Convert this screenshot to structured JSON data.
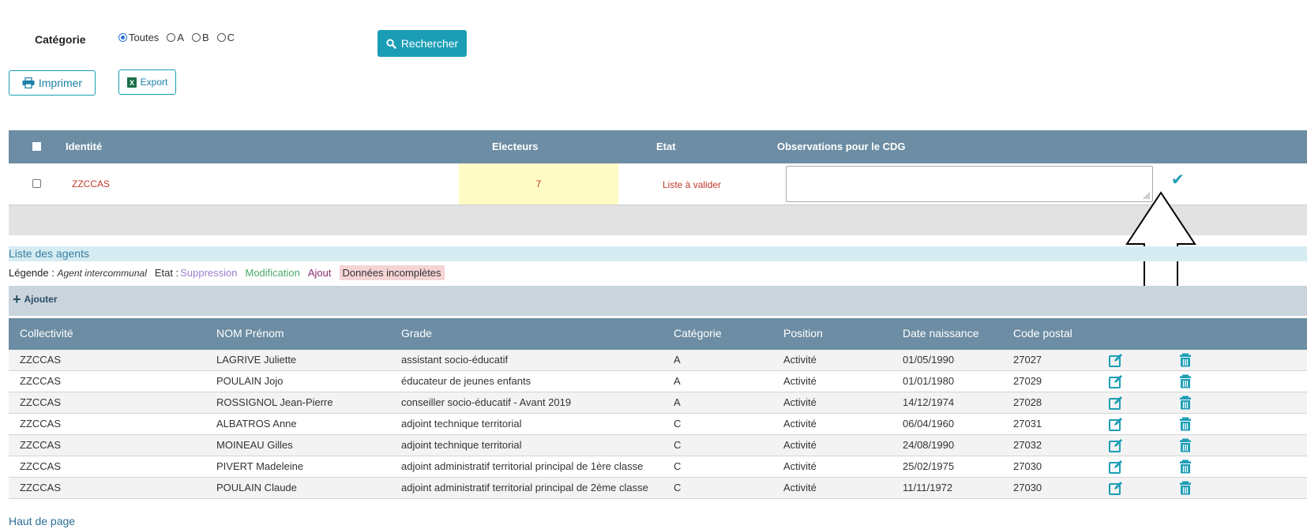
{
  "filters": {
    "category_label": "Catégorie",
    "options": [
      {
        "label": "Toutes",
        "checked": true
      },
      {
        "label": "A",
        "checked": false
      },
      {
        "label": "B",
        "checked": false
      },
      {
        "label": "C",
        "checked": false
      }
    ],
    "search_label": "Rechercher"
  },
  "actions": {
    "print_label": "Imprimer",
    "export_label": "Export"
  },
  "summary_table": {
    "headers": {
      "identity": "Identité",
      "electeurs": "Electeurs",
      "etat": "Etat",
      "observations": "Observations pour le CDG"
    },
    "row": {
      "identity": "ZZCCAS",
      "electeurs": "7",
      "etat": "Liste à valider",
      "observations": ""
    }
  },
  "agents": {
    "title": "Liste des agents",
    "legend": {
      "legende_label": "Légende :",
      "intercommunal": "Agent intercommunal",
      "etat_label": "Etat :",
      "suppression": "Suppression",
      "modification": "Modification",
      "ajout": "Ajout",
      "incompletes": "Données incomplètes"
    },
    "add_label": "Ajouter",
    "columns": [
      "Collectivité",
      "NOM Prénom",
      "Grade",
      "Catégorie",
      "Position",
      "Date naissance",
      "Code postal"
    ],
    "rows": [
      [
        "ZZCCAS",
        "LAGRIVE Juliette",
        "assistant socio-éducatif",
        "A",
        "Activité",
        "01/05/1990",
        "27027"
      ],
      [
        "ZZCCAS",
        "POULAIN Jojo",
        "éducateur de jeunes enfants",
        "A",
        "Activité",
        "01/01/1980",
        "27029"
      ],
      [
        "ZZCCAS",
        "ROSSIGNOL Jean-Pierre",
        "conseiller socio-éducatif - Avant 2019",
        "A",
        "Activité",
        "14/12/1974",
        "27028"
      ],
      [
        "ZZCCAS",
        "ALBATROS Anne",
        "adjoint technique territorial",
        "C",
        "Activité",
        "06/04/1960",
        "27031"
      ],
      [
        "ZZCCAS",
        "MOINEAU Gilles",
        "adjoint technique territorial",
        "C",
        "Activité",
        "24/08/1990",
        "27032"
      ],
      [
        "ZZCCAS",
        "PIVERT Madeleine",
        "adjoint administratif territorial principal de 1ère classe",
        "C",
        "Activité",
        "25/02/1975",
        "27030"
      ],
      [
        "ZZCCAS",
        "POULAIN Claude",
        "adjoint administratif territorial principal de 2ème classe",
        "C",
        "Activité",
        "11/11/1972",
        "27030"
      ]
    ]
  },
  "footer": {
    "top_link": "Haut de page"
  },
  "colors": {
    "accent": "#1b9eb5",
    "header": "#6c8da3",
    "alert": "#c0392b"
  },
  "icons": [
    "search-icon",
    "print-icon",
    "excel-icon",
    "check-icon",
    "plus-icon",
    "edit-icon",
    "trash-icon",
    "arrow-up-icon"
  ]
}
